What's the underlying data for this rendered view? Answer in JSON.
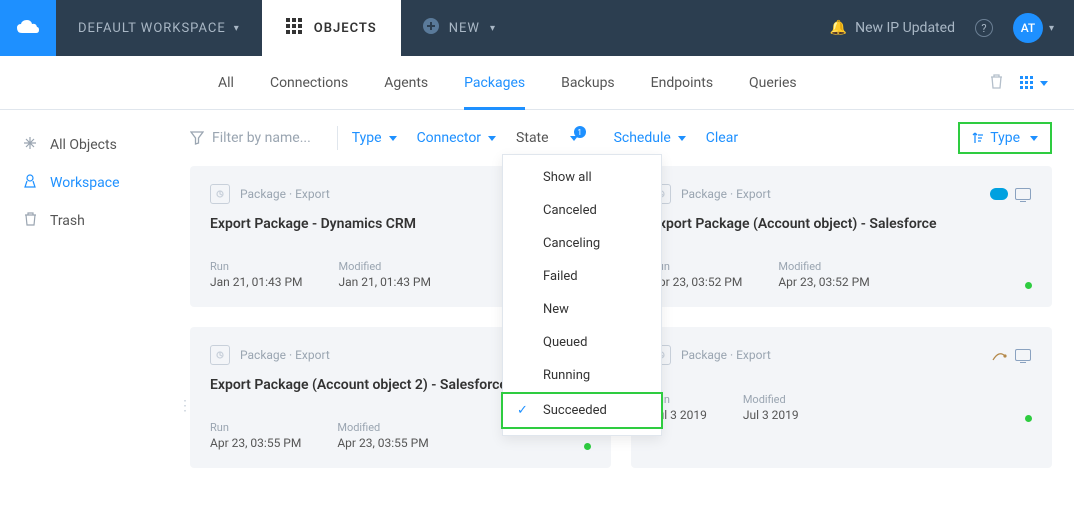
{
  "topbar": {
    "workspace_label": "DEFAULT WORKSPACE",
    "objects_label": "OBJECTS",
    "new_label": "NEW",
    "notification_text": "New IP Updated",
    "avatar_initials": "AT"
  },
  "tabs": {
    "items": [
      "All",
      "Connections",
      "Agents",
      "Packages",
      "Backups",
      "Endpoints",
      "Queries"
    ],
    "active_index": 3
  },
  "sidebar": {
    "items": [
      {
        "label": "All Objects",
        "icon": "sparkle"
      },
      {
        "label": "Workspace",
        "icon": "workspace"
      },
      {
        "label": "Trash",
        "icon": "trash"
      }
    ],
    "active_index": 1
  },
  "filters": {
    "search_placeholder": "Filter by name...",
    "type_label": "Type",
    "connector_label": "Connector",
    "state_label": "State",
    "state_badge": "1",
    "schedule_label": "Schedule",
    "clear_label": "Clear",
    "sort_label": "Type"
  },
  "state_menu": {
    "items": [
      "Show all",
      "Canceled",
      "Canceling",
      "Failed",
      "New",
      "Queued",
      "Running",
      "Succeeded"
    ],
    "selected_index": 7
  },
  "cards": [
    {
      "breadcrumb": "Package · Export",
      "title": "Export Package - Dynamics CRM",
      "run_label": "Run",
      "run_value": "Jan 21, 01:43 PM",
      "mod_label": "Modified",
      "mod_value": "Jan 21, 01:43 PM",
      "source_icon": "dynamics"
    },
    {
      "breadcrumb": "Package · Export",
      "title": "Export Package (Account object) - Salesforce",
      "run_label": "Run",
      "run_value": "Apr 23, 03:52 PM",
      "mod_label": "Modified",
      "mod_value": "Apr 23, 03:52 PM",
      "source_icon": "salesforce"
    },
    {
      "breadcrumb": "Package · Export",
      "title": "Export Package (Account object 2) - Salesforce",
      "run_label": "Run",
      "run_value": "Apr 23, 03:55 PM",
      "mod_label": "Modified",
      "mod_value": "Apr 23, 03:55 PM",
      "source_icon": "salesforce"
    },
    {
      "breadcrumb": "Package · Export",
      "title": " ",
      "run_label": "Run",
      "run_value": "Jul 3 2019",
      "mod_label": "Modified",
      "mod_value": "Jul 3 2019",
      "source_icon": "query"
    }
  ]
}
